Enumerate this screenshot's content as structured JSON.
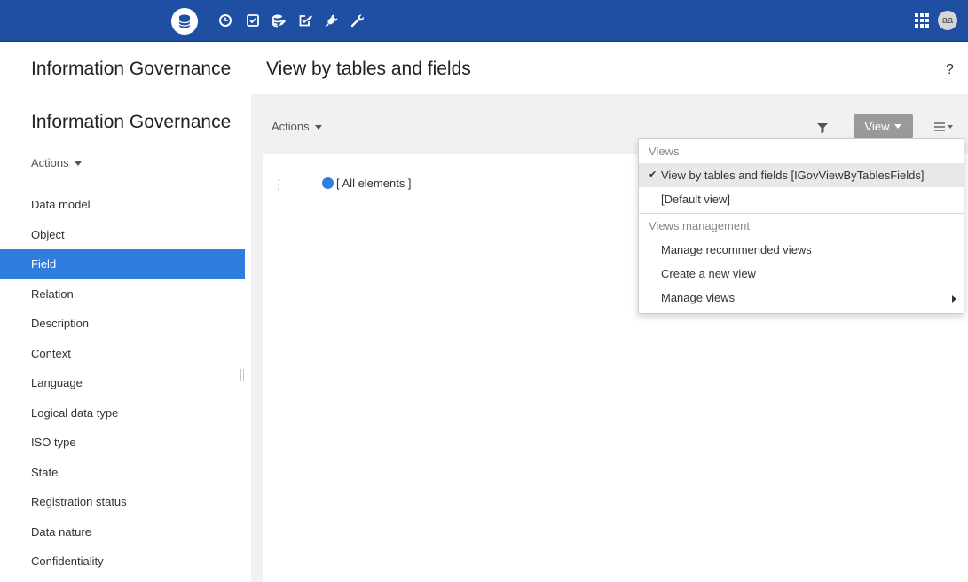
{
  "topbar": {
    "modules": [
      {
        "icon": "database-icon",
        "active": true
      },
      {
        "icon": "clock-icon",
        "active": false
      },
      {
        "icon": "checklist-icon",
        "active": false
      },
      {
        "icon": "database-edit-icon",
        "active": false
      },
      {
        "icon": "task-edit-icon",
        "active": false
      },
      {
        "icon": "plug-icon",
        "active": false
      },
      {
        "icon": "wrench-icon",
        "active": false
      }
    ],
    "apps_icon": "grid-icon",
    "avatar_initials": "aa"
  },
  "header": {
    "app_title": "Information Governance",
    "page_title": "View by tables and fields",
    "help": "?"
  },
  "sidebar": {
    "title": "Information Governance",
    "actions_label": "Actions",
    "items": [
      {
        "label": "Data model",
        "selected": false
      },
      {
        "label": "Object",
        "selected": false
      },
      {
        "label": "Field",
        "selected": true
      },
      {
        "label": "Relation",
        "selected": false
      },
      {
        "label": "Description",
        "selected": false
      },
      {
        "label": "Context",
        "selected": false
      },
      {
        "label": "Language",
        "selected": false
      },
      {
        "label": "Logical data type",
        "selected": false
      },
      {
        "label": "ISO type",
        "selected": false
      },
      {
        "label": "State",
        "selected": false
      },
      {
        "label": "Registration status",
        "selected": false
      },
      {
        "label": "Data nature",
        "selected": false
      },
      {
        "label": "Confidentiality",
        "selected": false
      }
    ]
  },
  "main": {
    "actions_label": "Actions",
    "view_button_label": "View",
    "tree_root_label": "[ All elements ]"
  },
  "view_menu": {
    "views_header": "Views",
    "views": [
      {
        "label": "View by tables and fields [IGovViewByTablesFields]",
        "current": true
      },
      {
        "label": "[Default view]",
        "current": false
      }
    ],
    "management_header": "Views management",
    "management": [
      {
        "label": "Manage recommended views",
        "submenu": false
      },
      {
        "label": "Create a new view",
        "submenu": false
      },
      {
        "label": "Manage views",
        "submenu": true
      }
    ]
  },
  "colors": {
    "topbar": "#1f4fa3",
    "selected": "#2f7dde",
    "view_button": "#9a9a9a"
  }
}
